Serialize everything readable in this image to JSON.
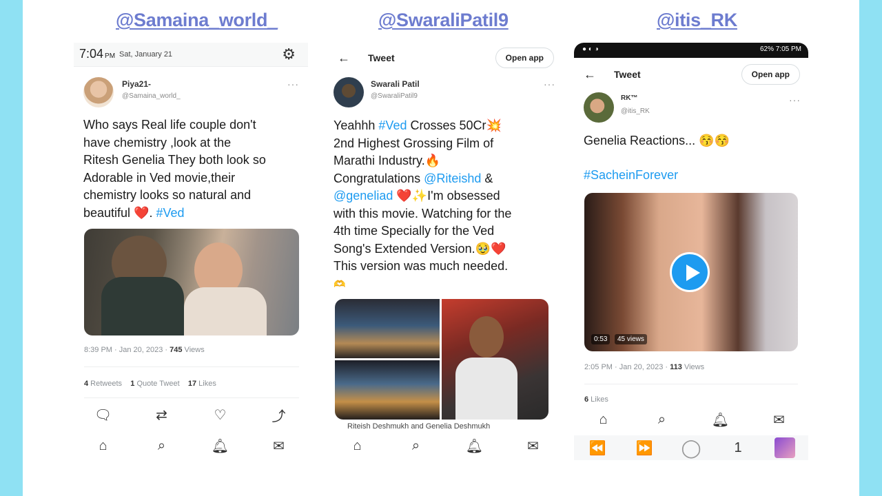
{
  "handles": [
    "@Samaina_world_",
    "@SwaraliPatil9",
    "@itis_RK"
  ],
  "phone1": {
    "time": "7:04",
    "ampm": "PM",
    "date": "Sat, January 21",
    "name": "Piya21-",
    "handle": "@Samaina_world_",
    "text": "Who says Real life couple don't\nhave chemistry ,look at the\nRitesh Genelia They both look so\nAdorable in Ved movie,their\nchemistry looks so natural and\nbeautiful ❤️. ",
    "hashtag": "#Ved",
    "meta_time": "8:39 PM · Jan 20, 2023 · ",
    "views_count": "745",
    "views_label": " Views",
    "retweets": "4",
    "retweets_label": " Retweets",
    "quotes": "1",
    "quotes_label": " Quote Tweet",
    "likes": "17",
    "likes_label": " Likes"
  },
  "phone2": {
    "header_title": "Tweet",
    "open_app": "Open app",
    "name": "Swarali Patil",
    "handle": "@SwaraliPatil9",
    "text_line1_a": "Yeahhh ",
    "text_tag1": "#Ved",
    "text_line1_b": " Crosses 50Cr💥",
    "text_line2": "2nd Highest Grossing Film of",
    "text_line3": "Marathi Industry.🔥",
    "text_line4_a": "Congratulations ",
    "text_mention1": "@Riteishd",
    "text_line4_b": " &",
    "text_mention2": "@geneliad",
    "text_line5_b": " ❤️✨I'm obsessed",
    "text_line6": "with this movie. Watching for the",
    "text_line7": "4th time Specially for the Ved",
    "text_line8": "Song's Extended Version.🥹❤️",
    "text_line9": "This version was much needed.",
    "text_line10": "🫶",
    "caption": "Riteish Deshmukh and Genelia Deshmukh"
  },
  "phone3": {
    "status": "62% 7:05 PM",
    "header_title": "Tweet",
    "open_app": "Open app",
    "name": "RK™",
    "handle": "@itis_RK",
    "text": "Genelia Reactions... 😚😚",
    "hashtag": "#SacheinForever",
    "video_time": "0:53",
    "video_views": "45 views",
    "meta_time": "2:05 PM · Jan 20, 2023 · ",
    "views_count": "113",
    "views_label": " Views",
    "likes": "6",
    "likes_label": " Likes",
    "media_counter": "1"
  }
}
